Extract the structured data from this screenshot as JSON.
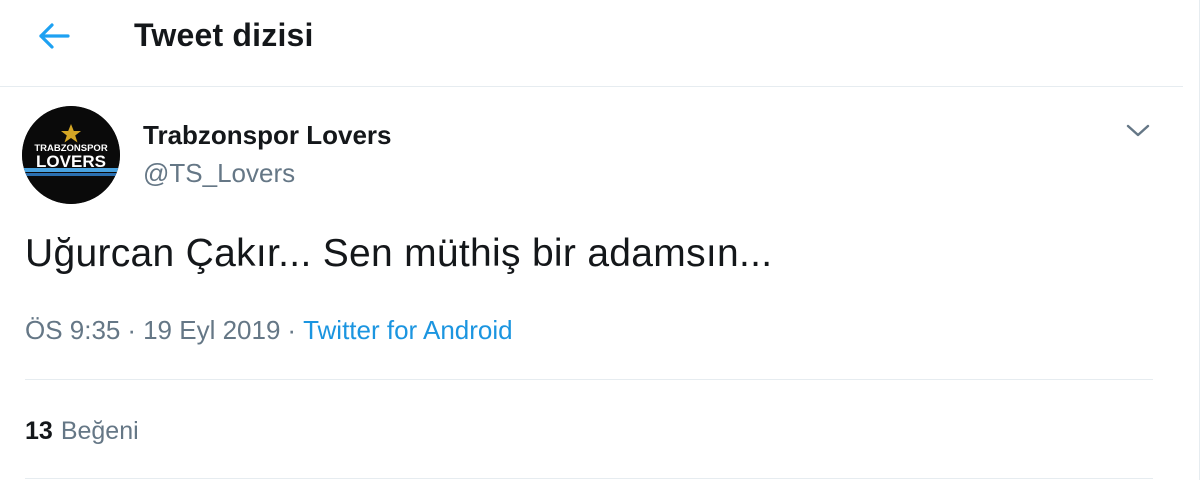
{
  "header": {
    "title": "Tweet dizisi",
    "back_icon": "arrow-left-icon",
    "accent_color": "#1da1f2"
  },
  "tweet": {
    "author": {
      "name": "Trabzonspor Lovers",
      "handle": "@TS_Lovers",
      "avatar_text_top": "TRABZONSPOR",
      "avatar_text_bottom": "LOVERS"
    },
    "menu_icon": "chevron-down-icon",
    "text": "Uğurcan Çakır... Sen müthiş bir adamsın...",
    "time": "ÖS 9:35",
    "separator": "·",
    "date": "19 Eyl 2019",
    "source": "Twitter for Android",
    "likes_count": "13",
    "likes_label": "Beğeni"
  },
  "colors": {
    "text_primary": "#14171a",
    "text_secondary": "#657786",
    "link": "#1b95e0",
    "divider": "#e6ecf0"
  }
}
